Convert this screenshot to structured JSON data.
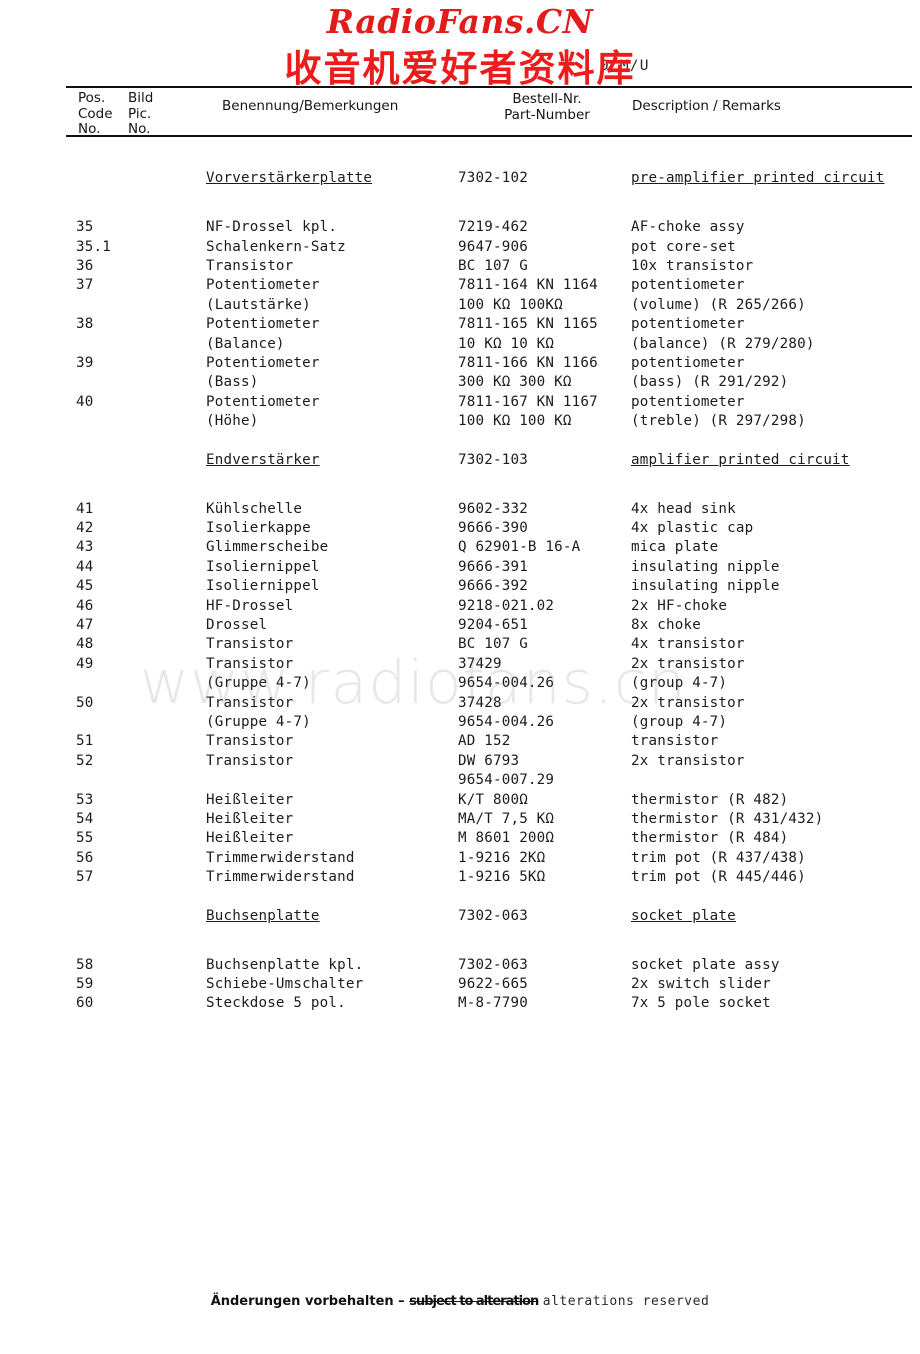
{
  "watermarks": {
    "brand": "RadioFans.CN",
    "brand_color": "#e21b1b",
    "chinese": "收音机爱好者资料库",
    "faint": "www.radiofans.cn"
  },
  "header": {
    "model_line": "0 M/U"
  },
  "table_header": {
    "pos_code_no": "Pos.\nCode\nNo.",
    "pos_l1": "Pos.",
    "pos_l2": "Code",
    "pos_l3": "No.",
    "bild_l1": "Bild",
    "bild_l2": "Pic.",
    "bild_l3": "No.",
    "benennung": "Benennung/Bemerkungen",
    "bestell_l1": "Bestell-Nr.",
    "bestell_l2": "Part-Number",
    "description": "Description / Remarks"
  },
  "rows": [
    {
      "kind": "gap"
    },
    {
      "kind": "section",
      "pos": "",
      "name": "Vorverstärkerplatte",
      "part": "7302-102",
      "desc": "pre-amplifier printed circuit"
    },
    {
      "kind": "gap"
    },
    {
      "kind": "gap-half"
    },
    {
      "kind": "item",
      "pos": "35",
      "name": "NF-Drossel kpl.",
      "part": "7219-462",
      "desc": "AF-choke assy"
    },
    {
      "kind": "item",
      "pos": "35.1",
      "name": "Schalenkern-Satz",
      "part": "9647-906",
      "desc": "pot core-set"
    },
    {
      "kind": "item",
      "pos": "36",
      "name": "Transistor",
      "part": "BC 107 G",
      "desc": "10x transistor"
    },
    {
      "kind": "item",
      "pos": "37",
      "name": "Potentiometer",
      "part": "7811-164 KN 1164",
      "desc": "potentiometer"
    },
    {
      "kind": "item",
      "pos": "",
      "name": "(Lautstärke)",
      "part": "100 KΩ 100KΩ",
      "desc": "(volume) (R 265/266)"
    },
    {
      "kind": "item",
      "pos": "38",
      "name": "Potentiometer",
      "part": "7811-165 KN 1165",
      "desc": "potentiometer"
    },
    {
      "kind": "item",
      "pos": "",
      "name": "(Balance)",
      "part": "10 KΩ  10 KΩ",
      "desc": "(balance) (R 279/280)"
    },
    {
      "kind": "item",
      "pos": "39",
      "name": "Potentiometer",
      "part": "7811-166 KN 1166",
      "desc": "potentiometer"
    },
    {
      "kind": "item",
      "pos": "",
      "name": "(Bass)",
      "part": "300 KΩ 300 KΩ",
      "desc": "(bass) (R 291/292)"
    },
    {
      "kind": "item",
      "pos": "40",
      "name": "Potentiometer",
      "part": "7811-167 KN 1167",
      "desc": "potentiometer"
    },
    {
      "kind": "item",
      "pos": "",
      "name": "(Höhe)",
      "part": "100 KΩ 100 KΩ",
      "desc": "(treble) (R 297/298)"
    },
    {
      "kind": "gap"
    },
    {
      "kind": "section",
      "pos": "",
      "name": "Endverstärker",
      "part": "7302-103",
      "desc": "amplifier printed circuit"
    },
    {
      "kind": "gap"
    },
    {
      "kind": "gap-half"
    },
    {
      "kind": "item",
      "pos": "41",
      "name": "Kühlschelle",
      "part": "9602-332",
      "desc": "4x head sink"
    },
    {
      "kind": "item",
      "pos": "42",
      "name": "Isolierkappe",
      "part": "9666-390",
      "desc": "4x plastic cap"
    },
    {
      "kind": "item",
      "pos": "43",
      "name": "Glimmerscheibe",
      "part": "Q 62901-B 16-A",
      "desc": "mica plate"
    },
    {
      "kind": "item",
      "pos": "44",
      "name": "Isoliernippel",
      "part": "9666-391",
      "desc": "insulating nipple"
    },
    {
      "kind": "item",
      "pos": "45",
      "name": "Isoliernippel",
      "part": "9666-392",
      "desc": "insulating nipple"
    },
    {
      "kind": "item",
      "pos": "46",
      "name": "HF-Drossel",
      "part": "9218-021.02",
      "desc": "2x HF-choke"
    },
    {
      "kind": "item",
      "pos": "47",
      "name": "Drossel",
      "part": "9204-651",
      "desc": "8x choke"
    },
    {
      "kind": "item",
      "pos": "48",
      "name": "Transistor",
      "part": "BC 107 G",
      "desc": "4x transistor"
    },
    {
      "kind": "item",
      "pos": "49",
      "name": "Transistor",
      "part": "37429",
      "desc": "2x transistor"
    },
    {
      "kind": "item",
      "pos": "",
      "name": "(Gruppe 4-7)",
      "part": "9654-004.26",
      "desc": "(group 4-7)"
    },
    {
      "kind": "item",
      "pos": "50",
      "name": "Transistor",
      "part": "37428",
      "desc": "2x transistor"
    },
    {
      "kind": "item",
      "pos": "",
      "name": "(Gruppe 4-7)",
      "part": "9654-004.26",
      "desc": "(group 4-7)"
    },
    {
      "kind": "item",
      "pos": "51",
      "name": "Transistor",
      "part": "AD 152",
      "desc": "transistor"
    },
    {
      "kind": "item",
      "pos": "52",
      "name": "Transistor",
      "part": "DW 6793",
      "desc": "2x transistor"
    },
    {
      "kind": "item",
      "pos": "",
      "name": "",
      "part": "9654-007.29",
      "desc": ""
    },
    {
      "kind": "item",
      "pos": "53",
      "name": "Heißleiter",
      "part": "K/T 800Ω",
      "desc": "thermistor (R 482)"
    },
    {
      "kind": "item",
      "pos": "54",
      "name": "Heißleiter",
      "part": "MA/T 7,5 KΩ",
      "desc": "thermistor (R 431/432)"
    },
    {
      "kind": "item",
      "pos": "55",
      "name": "Heißleiter",
      "part": "M 8601 200Ω",
      "desc": "thermistor (R 484)"
    },
    {
      "kind": "item",
      "pos": "56",
      "name": "Trimmerwiderstand",
      "part": "1-9216 2KΩ",
      "desc": "trim pot (R 437/438)"
    },
    {
      "kind": "item",
      "pos": "57",
      "name": "Trimmerwiderstand",
      "part": "1-9216 5KΩ",
      "desc": "trim pot (R 445/446)"
    },
    {
      "kind": "gap"
    },
    {
      "kind": "section",
      "pos": "",
      "name": "Buchsenplatte",
      "part": "7302-063",
      "desc": "socket plate"
    },
    {
      "kind": "gap"
    },
    {
      "kind": "gap-half"
    },
    {
      "kind": "item",
      "pos": "58",
      "name": "Buchsenplatte kpl.",
      "part": "7302-063",
      "desc": "socket plate assy"
    },
    {
      "kind": "item",
      "pos": "59",
      "name": "Schiebe-Umschalter",
      "part": "9622-665",
      "desc": "2x switch slider"
    },
    {
      "kind": "item",
      "pos": "60",
      "name": "Steckdose 5 pol.",
      "part": "M-8-7790",
      "desc": "7x 5 pole socket"
    }
  ],
  "footer": {
    "german": "Änderungen vorbehalten – ",
    "struck": "subject to alteration",
    "typed": "alterations reserved"
  }
}
